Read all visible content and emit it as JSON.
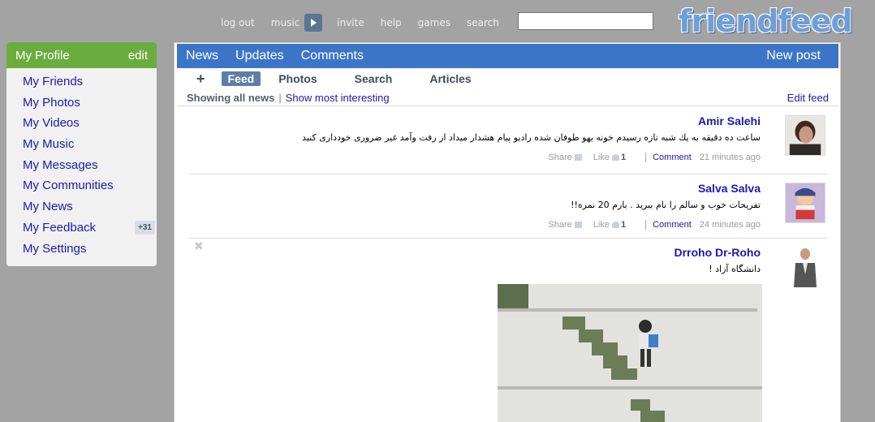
{
  "topnav": {
    "logout": "log out",
    "music": "music",
    "invite": "invite",
    "help": "help",
    "games": "games",
    "search": "search",
    "search_value": ""
  },
  "logo": "friendfeed",
  "sidebar": {
    "title": "My Profile",
    "edit": "edit",
    "items": [
      {
        "label": "My Friends"
      },
      {
        "label": "My Photos"
      },
      {
        "label": "My Videos"
      },
      {
        "label": "My Music"
      },
      {
        "label": "My Messages"
      },
      {
        "label": "My Communities"
      },
      {
        "label": "My News"
      },
      {
        "label": "My Feedback",
        "badge": "+31"
      },
      {
        "label": "My Settings"
      }
    ]
  },
  "main": {
    "tabs": [
      "News",
      "Updates",
      "Comments"
    ],
    "new_post": "New post",
    "subtabs": {
      "plus": "+",
      "items": [
        "Feed",
        "Photos",
        "Search",
        "Articles"
      ],
      "active": "Feed"
    },
    "showbar": {
      "all": "Showing all news",
      "sep": "|",
      "interesting": "Show most interesting",
      "edit_feed": "Edit feed"
    }
  },
  "entries": [
    {
      "author": "Amir Salehi",
      "text": "ساعت ده دقیقه به یك شبه تازه رسیدم خونه یهو طوفان شده رادیو پیام هشدار میداد از رفت وآمد غیر ضروری خودداری کنید",
      "share": "Share",
      "like": "Like",
      "like_count": "1",
      "comment": "Comment",
      "time": "21 minutes ago"
    },
    {
      "author": "Salva Salva",
      "text": "تفریحات خوب و سالم را نام ببرید . بارم 20 نمره!!",
      "share": "Share",
      "like": "Like",
      "like_count": "1",
      "comment": "Comment",
      "time": "24 minutes ago"
    },
    {
      "author": "Drroho Dr-Roho",
      "text": "دانشگاه آزاد !",
      "close": "✖"
    }
  ],
  "colors": {
    "background": "#a3a3a3",
    "sidebar_header": "#6bac3f",
    "tab_bar": "#3c75c8",
    "link": "#1a1ab0"
  }
}
